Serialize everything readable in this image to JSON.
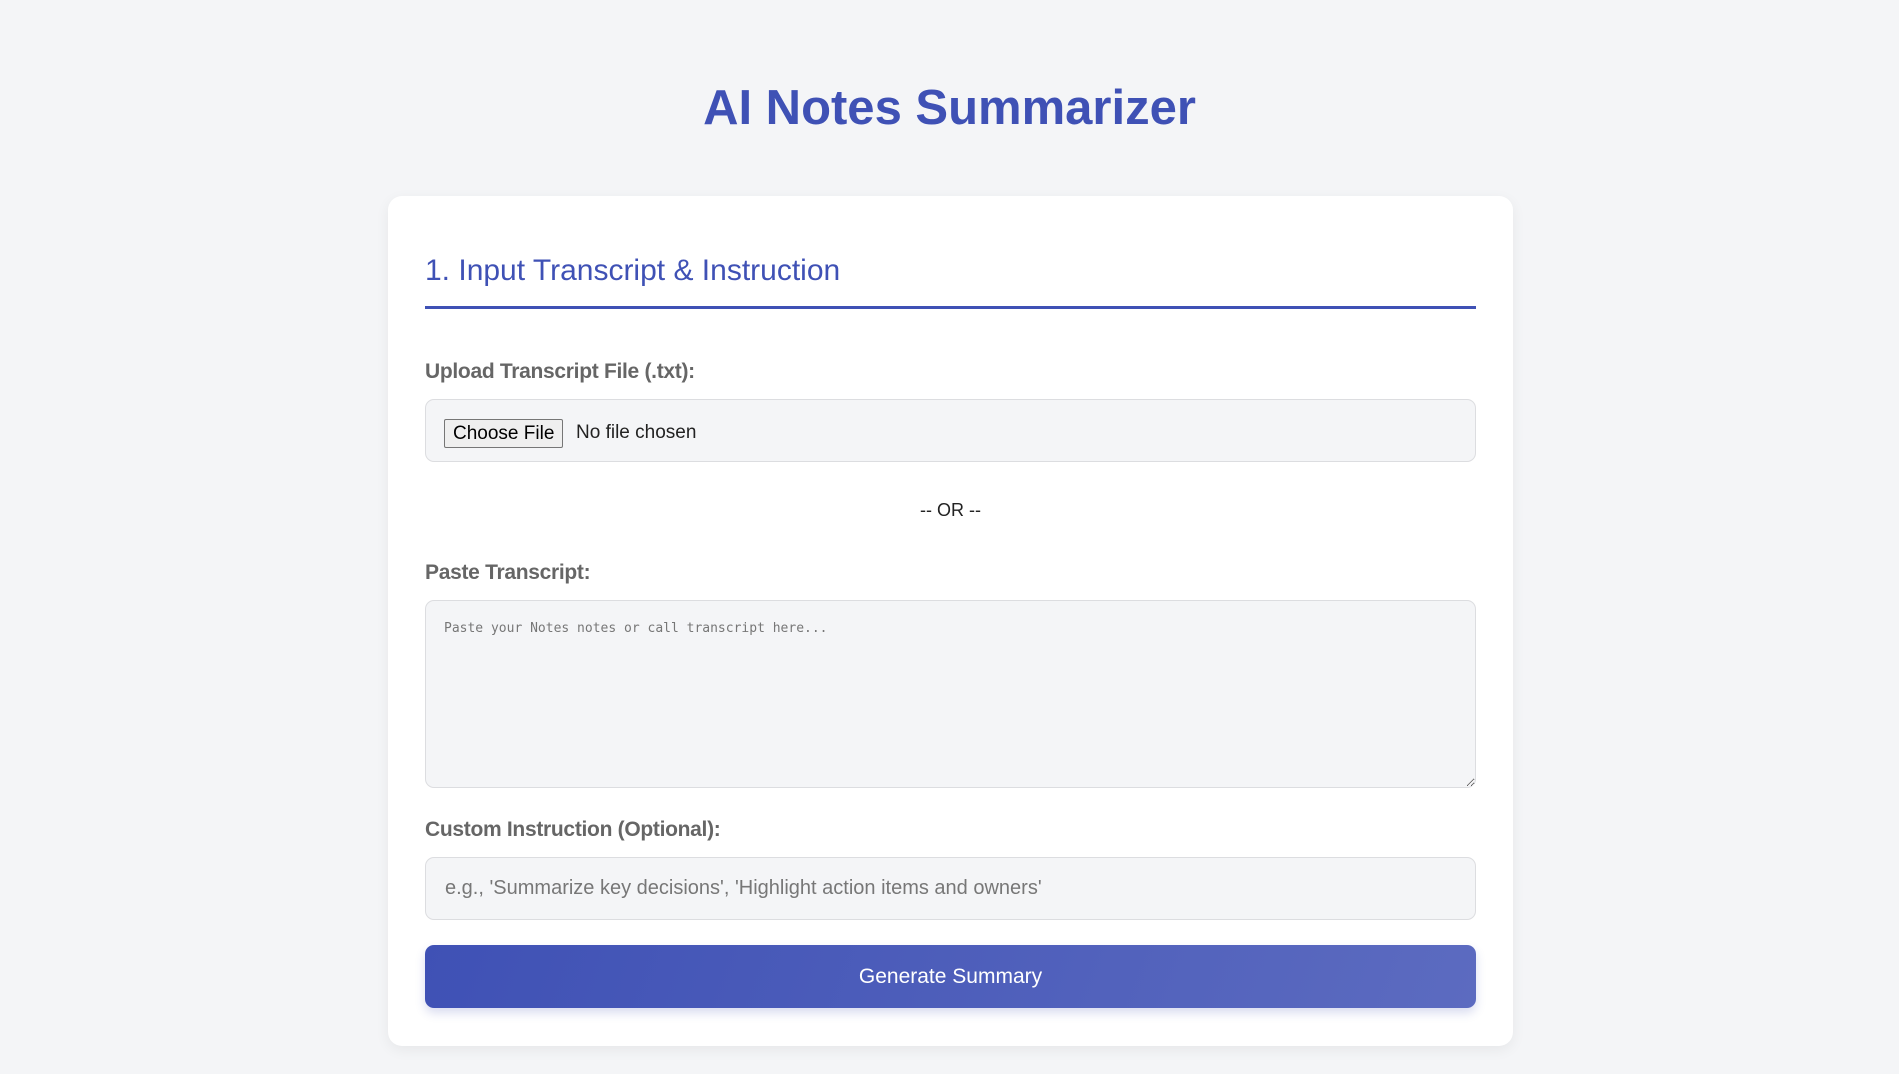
{
  "title": "AI Notes Summarizer",
  "section": {
    "heading": "1. Input Transcript & Instruction",
    "upload_label": "Upload Transcript File (.txt):",
    "choose_file_label": "Choose File",
    "no_file_text": "No file chosen",
    "or_text": "-- OR --",
    "paste_label": "Paste Transcript:",
    "paste_placeholder": "Paste your Notes notes or call transcript here...",
    "instruction_label": "Custom Instruction (Optional):",
    "instruction_placeholder": "e.g., 'Summarize key decisions', 'Highlight action items and owners'",
    "generate_label": "Generate Summary"
  }
}
